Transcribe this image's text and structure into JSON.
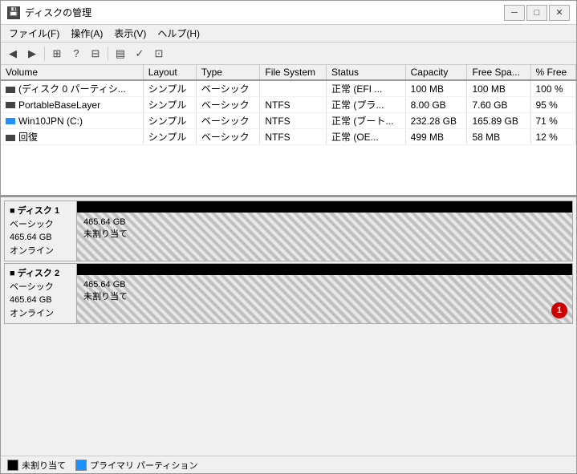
{
  "window": {
    "title": "ディスクの管理",
    "title_icon": "💾"
  },
  "menus": [
    {
      "label": "ファイル(F)"
    },
    {
      "label": "操作(A)"
    },
    {
      "label": "表示(V)"
    },
    {
      "label": "ヘルプ(H)"
    }
  ],
  "toolbar": {
    "buttons": [
      "◀",
      "▶",
      "⊞",
      "?",
      "⊟",
      "▤",
      "✓",
      "⊡"
    ]
  },
  "table": {
    "headers": [
      "Volume",
      "Layout",
      "Type",
      "File System",
      "Status",
      "Capacity",
      "Free Spa...",
      "% Free"
    ],
    "rows": [
      {
        "volume": "(ディスク 0 パーティシ...",
        "layout": "シンプル",
        "type": "ベーシック",
        "filesystem": "",
        "status": "正常 (EFI ...",
        "capacity": "100 MB",
        "free": "100 MB",
        "percent": "100 %",
        "icon": "grey"
      },
      {
        "volume": "PortableBaseLayer",
        "layout": "シンプル",
        "type": "ベーシック",
        "filesystem": "NTFS",
        "status": "正常 (プラ...",
        "capacity": "8.00 GB",
        "free": "7.60 GB",
        "percent": "95 %",
        "icon": "grey"
      },
      {
        "volume": "Win10JPN (C:)",
        "layout": "シンプル",
        "type": "ベーシック",
        "filesystem": "NTFS",
        "status": "正常 (ブート...",
        "capacity": "232.28 GB",
        "free": "165.89 GB",
        "percent": "71 %",
        "icon": "blue"
      },
      {
        "volume": "回復",
        "layout": "シンプル",
        "type": "ベーシック",
        "filesystem": "NTFS",
        "status": "正常 (OE...",
        "capacity": "499 MB",
        "free": "58 MB",
        "percent": "12 %",
        "icon": "grey"
      }
    ]
  },
  "disks": [
    {
      "name": "ディスク 1",
      "type": "ベーシック",
      "size": "465.64 GB",
      "status": "オンライン",
      "capacity_label": "465.64 GB",
      "unallocated_label": "未割り当て",
      "badge": null
    },
    {
      "name": "ディスク 2",
      "type": "ベーシック",
      "size": "465.64 GB",
      "status": "オンライン",
      "capacity_label": "465.64 GB",
      "unallocated_label": "未割り当て",
      "badge": "1"
    }
  ],
  "legend": [
    {
      "label": "未割り当て",
      "color": "black"
    },
    {
      "label": "プライマリ パーティション",
      "color": "blue"
    }
  ],
  "title_controls": {
    "minimize": "─",
    "maximize": "□",
    "close": "✕"
  }
}
